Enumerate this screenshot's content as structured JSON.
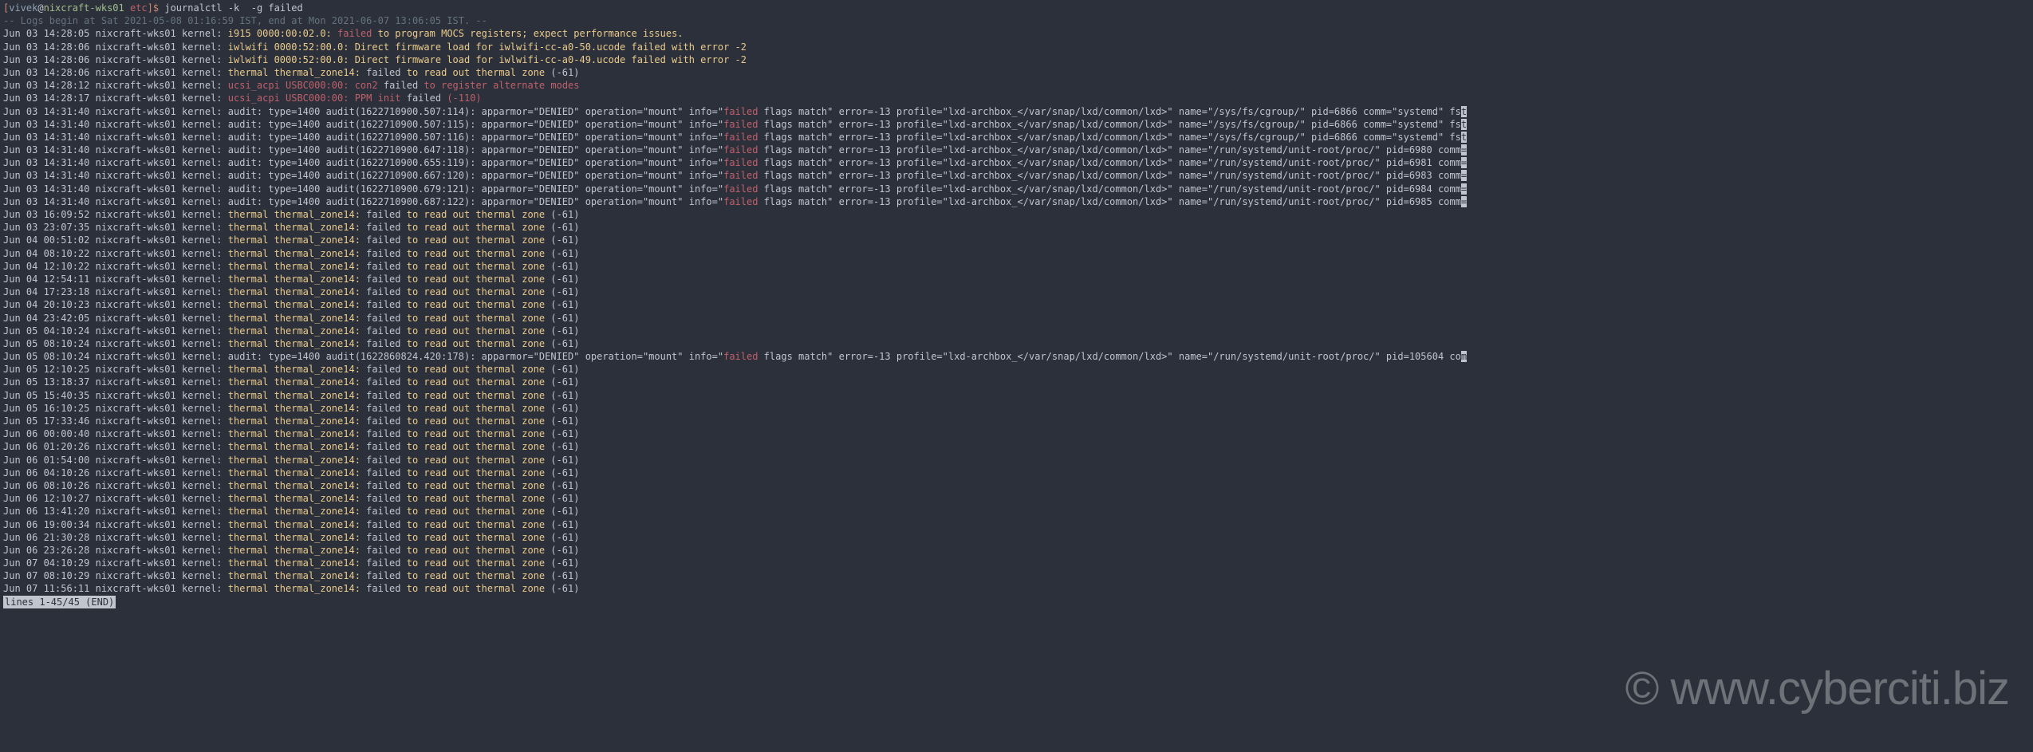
{
  "prompt": {
    "bracket_open": "[",
    "user": "vivek",
    "at": "@",
    "host": "nixcraft-wks01",
    "path": "etc",
    "bracket_close": "]$",
    "command": "journalctl -k  -g failed"
  },
  "header_line": "-- Logs begin at Sat 2021-05-08 01:16:59 IST, end at Mon 2021-06-07 13:06:05 IST. --",
  "watermark": "© www.cyberciti.biz",
  "status": "lines 1-45/45 (END)",
  "lines": [
    {
      "ts": "Jun 03 14:28:05",
      "src": "i915 0000:00:02.0:",
      "red1": "failed",
      "tail": " to program MOCS registers; expect performance issues."
    },
    {
      "ts": "Jun 03 14:28:06",
      "src": "iwlwifi 0000:52:00.0: Direct firmware load for iwlwifi-cc-a0-50.ucode failed with error -2"
    },
    {
      "ts": "Jun 03 14:28:06",
      "src": "iwlwifi 0000:52:00.0: Direct firmware load for iwlwifi-cc-a0-49.ucode failed with error -2"
    },
    {
      "ts": "Jun 03 14:28:06",
      "src": "thermal thermal_zone14:",
      "fail": "failed",
      "tail": " to read out thermal zone ",
      "code": "(-61)"
    },
    {
      "ts": "Jun 03 14:28:12",
      "redsrc": "ucsi_acpi USBC000:00: con2",
      "fail": "failed ",
      "redtail": "to register alternate modes"
    },
    {
      "ts": "Jun 03 14:28:17",
      "redsrc": "ucsi_acpi USBC000:00: PPM init",
      "fail": "failed ",
      "redtail": "(-110)"
    },
    {
      "ts": "Jun 03 14:31:40",
      "aud": "audit: type=1400 audit(1622710900.507:114): apparmor=\"DENIED\" operation=\"mount\" info=\"",
      "red1": "failed",
      "mid": " flags match\" error=-13 profile=\"lxd-archbox_</var/snap/lxd/common/lxd>\" name=\"/sys/fs/cgroup/\" pid=6866 comm=\"systemd\" fs",
      "trunc": "t"
    },
    {
      "ts": "Jun 03 14:31:40",
      "aud": "audit: type=1400 audit(1622710900.507:115): apparmor=\"DENIED\" operation=\"mount\" info=\"",
      "red1": "failed",
      "mid": " flags match\" error=-13 profile=\"lxd-archbox_</var/snap/lxd/common/lxd>\" name=\"/sys/fs/cgroup/\" pid=6866 comm=\"systemd\" fs",
      "trunc": "t"
    },
    {
      "ts": "Jun 03 14:31:40",
      "aud": "audit: type=1400 audit(1622710900.507:116): apparmor=\"DENIED\" operation=\"mount\" info=\"",
      "red1": "failed",
      "mid": " flags match\" error=-13 profile=\"lxd-archbox_</var/snap/lxd/common/lxd>\" name=\"/sys/fs/cgroup/\" pid=6866 comm=\"systemd\" fs",
      "trunc": "t"
    },
    {
      "ts": "Jun 03 14:31:40",
      "aud": "audit: type=1400 audit(1622710900.647:118): apparmor=\"DENIED\" operation=\"mount\" info=\"",
      "red1": "failed",
      "mid": " flags match\" error=-13 profile=\"lxd-archbox_</var/snap/lxd/common/lxd>\" name=\"/run/systemd/unit-root/proc/\" pid=6980 comm",
      "trunc": "="
    },
    {
      "ts": "Jun 03 14:31:40",
      "aud": "audit: type=1400 audit(1622710900.655:119): apparmor=\"DENIED\" operation=\"mount\" info=\"",
      "red1": "failed",
      "mid": " flags match\" error=-13 profile=\"lxd-archbox_</var/snap/lxd/common/lxd>\" name=\"/run/systemd/unit-root/proc/\" pid=6981 comm",
      "trunc": "="
    },
    {
      "ts": "Jun 03 14:31:40",
      "aud": "audit: type=1400 audit(1622710900.667:120): apparmor=\"DENIED\" operation=\"mount\" info=\"",
      "red1": "failed",
      "mid": " flags match\" error=-13 profile=\"lxd-archbox_</var/snap/lxd/common/lxd>\" name=\"/run/systemd/unit-root/proc/\" pid=6983 comm",
      "trunc": "="
    },
    {
      "ts": "Jun 03 14:31:40",
      "aud": "audit: type=1400 audit(1622710900.679:121): apparmor=\"DENIED\" operation=\"mount\" info=\"",
      "red1": "failed",
      "mid": " flags match\" error=-13 profile=\"lxd-archbox_</var/snap/lxd/common/lxd>\" name=\"/run/systemd/unit-root/proc/\" pid=6984 comm",
      "trunc": "="
    },
    {
      "ts": "Jun 03 14:31:40",
      "aud": "audit: type=1400 audit(1622710900.687:122): apparmor=\"DENIED\" operation=\"mount\" info=\"",
      "red1": "failed",
      "mid": " flags match\" error=-13 profile=\"lxd-archbox_</var/snap/lxd/common/lxd>\" name=\"/run/systemd/unit-root/proc/\" pid=6985 comm",
      "trunc": "="
    },
    {
      "ts": "Jun 03 16:09:52",
      "src": "thermal thermal_zone14:",
      "fail": "failed",
      "tail": " to read out thermal zone ",
      "code": "(-61)"
    },
    {
      "ts": "Jun 03 23:07:35",
      "src": "thermal thermal_zone14:",
      "fail": "failed",
      "tail": " to read out thermal zone ",
      "code": "(-61)"
    },
    {
      "ts": "Jun 04 00:51:02",
      "src": "thermal thermal_zone14:",
      "fail": "failed",
      "tail": " to read out thermal zone ",
      "code": "(-61)"
    },
    {
      "ts": "Jun 04 08:10:22",
      "src": "thermal thermal_zone14:",
      "fail": "failed",
      "tail": " to read out thermal zone ",
      "code": "(-61)"
    },
    {
      "ts": "Jun 04 12:10:22",
      "src": "thermal thermal_zone14:",
      "fail": "failed",
      "tail": " to read out thermal zone ",
      "code": "(-61)"
    },
    {
      "ts": "Jun 04 12:54:11",
      "src": "thermal thermal_zone14:",
      "fail": "failed",
      "tail": " to read out thermal zone ",
      "code": "(-61)"
    },
    {
      "ts": "Jun 04 17:23:18",
      "src": "thermal thermal_zone14:",
      "fail": "failed",
      "tail": " to read out thermal zone ",
      "code": "(-61)"
    },
    {
      "ts": "Jun 04 20:10:23",
      "src": "thermal thermal_zone14:",
      "fail": "failed",
      "tail": " to read out thermal zone ",
      "code": "(-61)"
    },
    {
      "ts": "Jun 04 23:42:05",
      "src": "thermal thermal_zone14:",
      "fail": "failed",
      "tail": " to read out thermal zone ",
      "code": "(-61)"
    },
    {
      "ts": "Jun 05 04:10:24",
      "src": "thermal thermal_zone14:",
      "fail": "failed",
      "tail": " to read out thermal zone ",
      "code": "(-61)"
    },
    {
      "ts": "Jun 05 08:10:24",
      "src": "thermal thermal_zone14:",
      "fail": "failed",
      "tail": " to read out thermal zone ",
      "code": "(-61)"
    },
    {
      "ts": "Jun 05 08:10:24",
      "aud": "audit: type=1400 audit(1622860824.420:178): apparmor=\"DENIED\" operation=\"mount\" info=\"",
      "red1": "failed",
      "mid": " flags match\" error=-13 profile=\"lxd-archbox_</var/snap/lxd/common/lxd>\" name=\"/run/systemd/unit-root/proc/\" pid=105604 co",
      "trunc": "m"
    },
    {
      "ts": "Jun 05 12:10:25",
      "src": "thermal thermal_zone14:",
      "fail": "failed",
      "tail": " to read out thermal zone ",
      "code": "(-61)"
    },
    {
      "ts": "Jun 05 13:18:37",
      "src": "thermal thermal_zone14:",
      "fail": "failed",
      "tail": " to read out thermal zone ",
      "code": "(-61)"
    },
    {
      "ts": "Jun 05 15:40:35",
      "src": "thermal thermal_zone14:",
      "fail": "failed",
      "tail": " to read out thermal zone ",
      "code": "(-61)"
    },
    {
      "ts": "Jun 05 16:10:25",
      "src": "thermal thermal_zone14:",
      "fail": "failed",
      "tail": " to read out thermal zone ",
      "code": "(-61)"
    },
    {
      "ts": "Jun 05 17:33:46",
      "src": "thermal thermal_zone14:",
      "fail": "failed",
      "tail": " to read out thermal zone ",
      "code": "(-61)"
    },
    {
      "ts": "Jun 06 00:00:40",
      "src": "thermal thermal_zone14:",
      "fail": "failed",
      "tail": " to read out thermal zone ",
      "code": "(-61)"
    },
    {
      "ts": "Jun 06 01:20:26",
      "src": "thermal thermal_zone14:",
      "fail": "failed",
      "tail": " to read out thermal zone ",
      "code": "(-61)"
    },
    {
      "ts": "Jun 06 01:54:00",
      "src": "thermal thermal_zone14:",
      "fail": "failed",
      "tail": " to read out thermal zone ",
      "code": "(-61)"
    },
    {
      "ts": "Jun 06 04:10:26",
      "src": "thermal thermal_zone14:",
      "fail": "failed",
      "tail": " to read out thermal zone ",
      "code": "(-61)"
    },
    {
      "ts": "Jun 06 08:10:26",
      "src": "thermal thermal_zone14:",
      "fail": "failed",
      "tail": " to read out thermal zone ",
      "code": "(-61)"
    },
    {
      "ts": "Jun 06 12:10:27",
      "src": "thermal thermal_zone14:",
      "fail": "failed",
      "tail": " to read out thermal zone ",
      "code": "(-61)"
    },
    {
      "ts": "Jun 06 13:41:20",
      "src": "thermal thermal_zone14:",
      "fail": "failed",
      "tail": " to read out thermal zone ",
      "code": "(-61)"
    },
    {
      "ts": "Jun 06 19:00:34",
      "src": "thermal thermal_zone14:",
      "fail": "failed",
      "tail": " to read out thermal zone ",
      "code": "(-61)"
    },
    {
      "ts": "Jun 06 21:30:28",
      "src": "thermal thermal_zone14:",
      "fail": "failed",
      "tail": " to read out thermal zone ",
      "code": "(-61)"
    },
    {
      "ts": "Jun 06 23:26:28",
      "src": "thermal thermal_zone14:",
      "fail": "failed",
      "tail": " to read out thermal zone ",
      "code": "(-61)"
    },
    {
      "ts": "Jun 07 04:10:29",
      "src": "thermal thermal_zone14:",
      "fail": "failed",
      "tail": " to read out thermal zone ",
      "code": "(-61)"
    },
    {
      "ts": "Jun 07 08:10:29",
      "src": "thermal thermal_zone14:",
      "fail": "failed",
      "tail": " to read out thermal zone ",
      "code": "(-61)"
    },
    {
      "ts": "Jun 07 11:56:11",
      "src": "thermal thermal_zone14:",
      "fail": "failed",
      "tail": " to read out thermal zone ",
      "code": "(-61)"
    }
  ],
  "host_kernel_prefix": " nixcraft-wks01 kernel: "
}
